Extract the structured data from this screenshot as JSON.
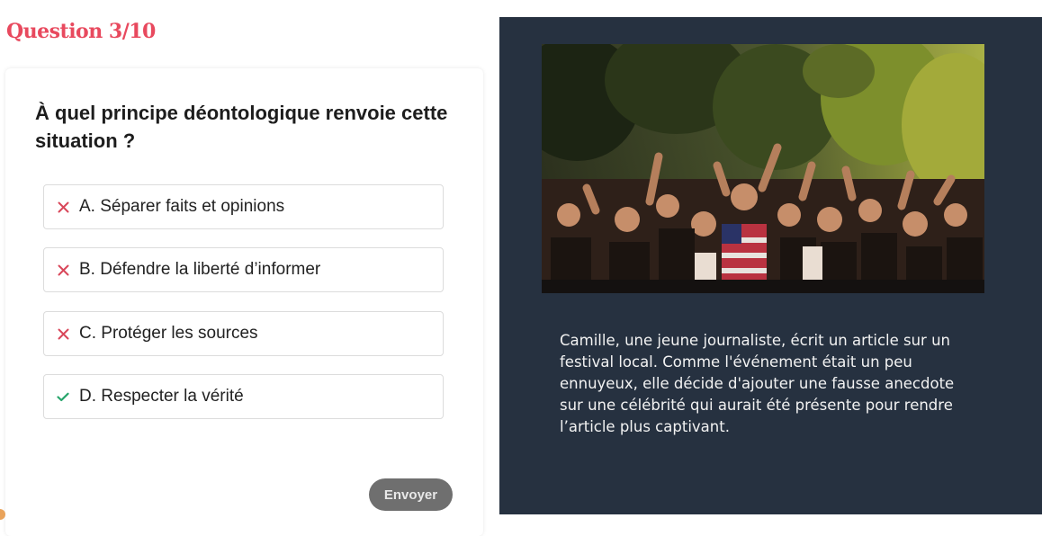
{
  "quiz": {
    "progress_label": "Question 3/10",
    "current_question": 3,
    "total_questions": 10,
    "question": "À quel principe déontologique renvoie cette situation ?",
    "options": [
      {
        "label": "A. Séparer faits et opinions",
        "status": "incorrect",
        "icon": "cross-icon"
      },
      {
        "label": "B. Défendre la liberté d’informer",
        "status": "incorrect",
        "icon": "cross-icon"
      },
      {
        "label": "C. Protéger les sources",
        "status": "incorrect",
        "icon": "cross-icon"
      },
      {
        "label": "D. Respecter la vérité",
        "status": "correct",
        "icon": "checkmark-icon"
      }
    ],
    "submit_label": "Envoyer"
  },
  "scenario": {
    "image": "festival-crowd-photo",
    "text": "Camille, une jeune journaliste, écrit un article sur un festival local. Comme l'événement était un peu ennuyeux, elle décide d'ajouter une fausse anecdote sur une célébrité qui aurait été présente pour rendre l’article plus captivant."
  },
  "colors": {
    "accent": "#e8495e",
    "incorrect": "#d9475a",
    "correct": "#27a56b",
    "panel_background": "#263140",
    "button_background": "#6f6f6f"
  }
}
